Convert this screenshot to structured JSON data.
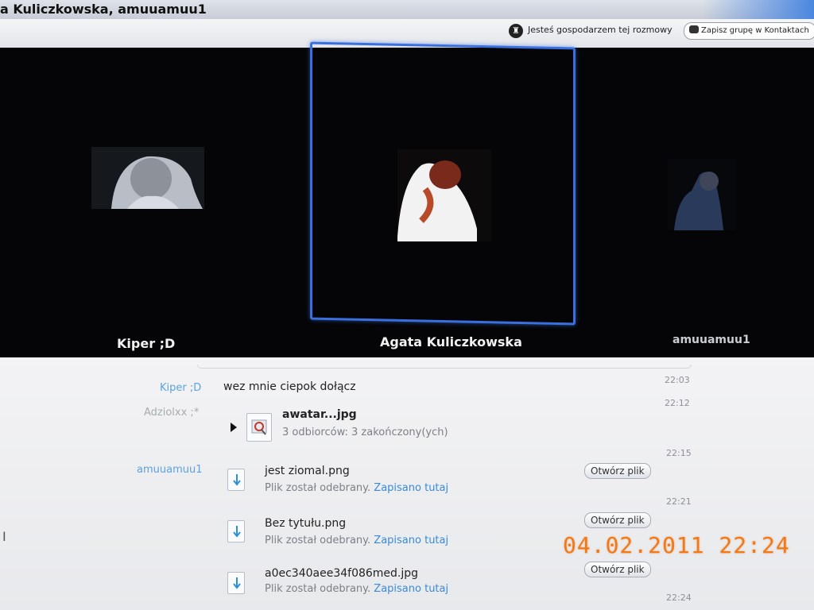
{
  "window": {
    "title": "a Kuliczkowska, amuuamuu1"
  },
  "hostbar": {
    "host_text": "Jesteś gospodarzem tej rozmowy",
    "save_group_label": "Zapisz grupę w Kontaktach"
  },
  "participants": [
    {
      "name": "Kiper ;D",
      "active": false
    },
    {
      "name": "Agata Kuliczkowska",
      "active": true
    },
    {
      "name": "amuuamuu1",
      "active": false
    }
  ],
  "colors": {
    "active_border": "#3a6fe0",
    "sender_blue": "#5aa2e0",
    "link_blue": "#3a8ad8",
    "date_stamp": "#f07a1a"
  },
  "chat": {
    "messages": [
      {
        "sender": "Kiper ;D",
        "text": "wez mnie ciepok dołącz",
        "time": "22:03"
      }
    ],
    "file_transfer_group": {
      "sender": "Adziolxx ;*",
      "time": "22:12",
      "file_name": "awatar...jpg",
      "status": "3 odbiorców: 3 zakończony(ych)"
    },
    "received_sender": "amuuamuu1",
    "received_files": [
      {
        "name": "jest ziomal.png",
        "status": "Plik został odebrany.",
        "link": "Zapisano tutaj",
        "button": "Otwórz plik",
        "time": "22:15"
      },
      {
        "name": "Bez tytułu.png",
        "status": "Plik został odebrany.",
        "link": "Zapisano tutaj",
        "button": "Otwórz plik",
        "time": "22:21"
      },
      {
        "name": "a0ec340aee34f086med.jpg",
        "status": "Plik został odebrany.",
        "link": "Zapisano tutaj",
        "button": "Otwórz plik",
        "time": "22:24"
      }
    ]
  },
  "camera_date_stamp": "04.02.2011 22:24",
  "icons": [
    "host-icon",
    "contacts-group-icon",
    "image-file-icon",
    "download-file-icon",
    "expand-arrow-icon"
  ]
}
